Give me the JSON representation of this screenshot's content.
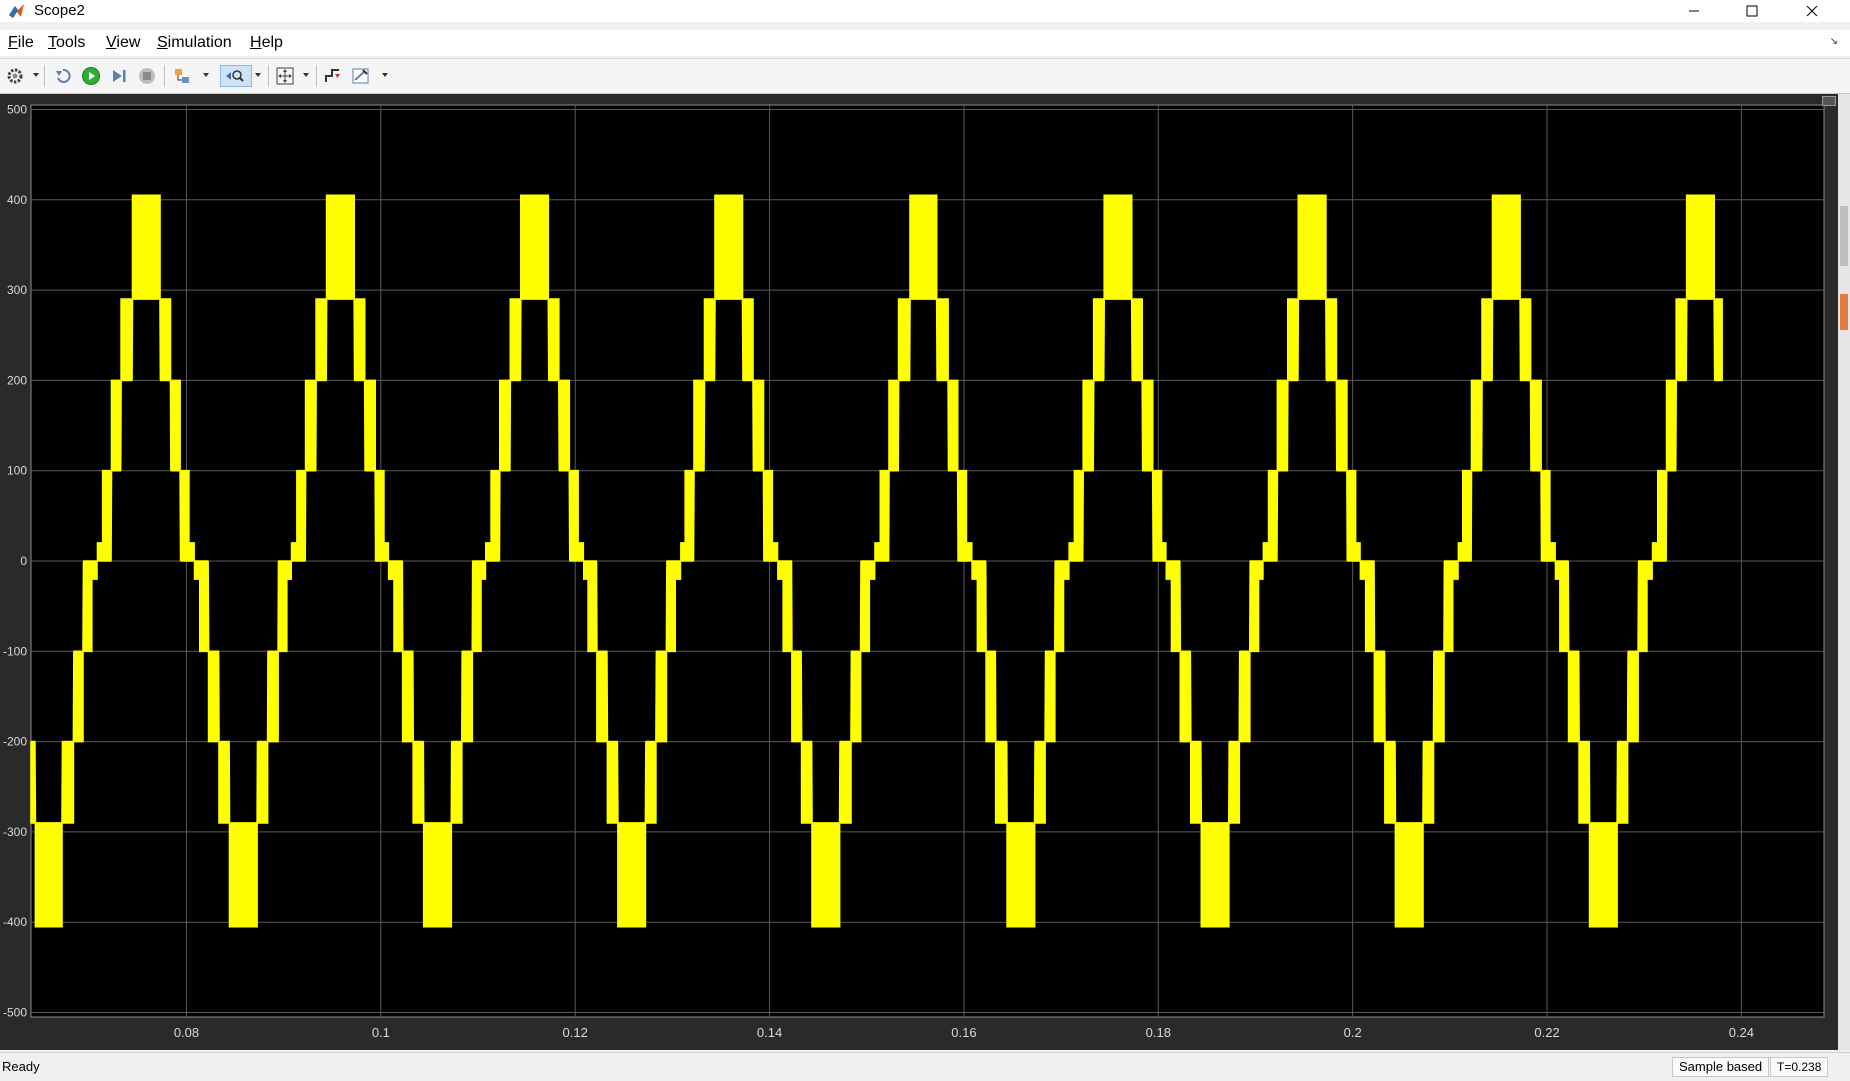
{
  "window": {
    "title": "Scope2"
  },
  "menu": {
    "items": [
      {
        "label": "File",
        "hotkey": "F",
        "rest": "ile"
      },
      {
        "label": "Tools",
        "hotkey": "T",
        "rest": "ools"
      },
      {
        "label": "View",
        "hotkey": "V",
        "rest": "iew"
      },
      {
        "label": "Simulation",
        "hotkey": "S",
        "rest": "imulation"
      },
      {
        "label": "Help",
        "hotkey": "H",
        "rest": "elp"
      }
    ]
  },
  "toolbar": {
    "icons": [
      "settings-icon",
      "step-back-icon",
      "run-icon",
      "step-forward-icon",
      "stop-icon",
      "highlight-simulink-block-icon",
      "zoom-icon",
      "autoscale-icon",
      "triggers-icon",
      "measurements-icon"
    ]
  },
  "chart_data": {
    "type": "line",
    "title": "",
    "xlabel": "",
    "ylabel": "",
    "xlim": [
      0.064,
      0.2485
    ],
    "ylim": [
      -505,
      505
    ],
    "xticks": [
      0.08,
      0.1,
      0.12,
      0.14,
      0.16,
      0.18,
      0.2,
      0.22,
      0.24
    ],
    "xtick_labels": [
      "0.08",
      "0.1",
      "0.12",
      "0.14",
      "0.16",
      "0.18",
      "0.2",
      "0.22",
      "0.24"
    ],
    "yticks": [
      500,
      400,
      300,
      200,
      100,
      0,
      -100,
      -200,
      -300,
      -400,
      -500
    ],
    "ytick_labels": [
      "500",
      "400",
      "300",
      "200",
      "100",
      "0",
      "-100",
      "-200",
      "-300",
      "-400",
      "-500"
    ],
    "grid": true,
    "background": "#000000",
    "grid_color": "#595959",
    "series": [
      {
        "color": "#ffff00",
        "signal": "multilevel PWM staircase waveform",
        "period": 0.02,
        "x_start": 0.064,
        "x_end": 0.238,
        "first_peak_x": 0.0758,
        "levels": [
          {
            "from": 0.0,
            "to": 100
          },
          {
            "from": 100,
            "to": 200
          },
          {
            "from": 200,
            "to": 290
          },
          {
            "from": 290,
            "to": 405
          }
        ],
        "end_value": 205
      }
    ]
  },
  "status": {
    "text": "Ready",
    "mode": "Sample based",
    "time": "T=0.238"
  }
}
